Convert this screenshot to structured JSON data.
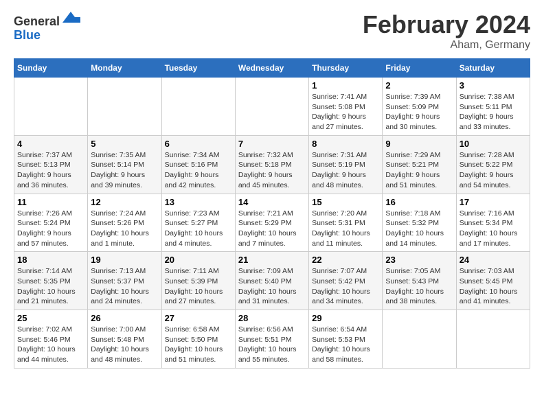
{
  "header": {
    "logo_general": "General",
    "logo_blue": "Blue",
    "main_title": "February 2024",
    "subtitle": "Aham, Germany"
  },
  "days_of_week": [
    "Sunday",
    "Monday",
    "Tuesday",
    "Wednesday",
    "Thursday",
    "Friday",
    "Saturday"
  ],
  "weeks": [
    [
      {
        "day": "",
        "info": ""
      },
      {
        "day": "",
        "info": ""
      },
      {
        "day": "",
        "info": ""
      },
      {
        "day": "",
        "info": ""
      },
      {
        "day": "1",
        "info": "Sunrise: 7:41 AM\nSunset: 5:08 PM\nDaylight: 9 hours and 27 minutes."
      },
      {
        "day": "2",
        "info": "Sunrise: 7:39 AM\nSunset: 5:09 PM\nDaylight: 9 hours and 30 minutes."
      },
      {
        "day": "3",
        "info": "Sunrise: 7:38 AM\nSunset: 5:11 PM\nDaylight: 9 hours and 33 minutes."
      }
    ],
    [
      {
        "day": "4",
        "info": "Sunrise: 7:37 AM\nSunset: 5:13 PM\nDaylight: 9 hours and 36 minutes."
      },
      {
        "day": "5",
        "info": "Sunrise: 7:35 AM\nSunset: 5:14 PM\nDaylight: 9 hours and 39 minutes."
      },
      {
        "day": "6",
        "info": "Sunrise: 7:34 AM\nSunset: 5:16 PM\nDaylight: 9 hours and 42 minutes."
      },
      {
        "day": "7",
        "info": "Sunrise: 7:32 AM\nSunset: 5:18 PM\nDaylight: 9 hours and 45 minutes."
      },
      {
        "day": "8",
        "info": "Sunrise: 7:31 AM\nSunset: 5:19 PM\nDaylight: 9 hours and 48 minutes."
      },
      {
        "day": "9",
        "info": "Sunrise: 7:29 AM\nSunset: 5:21 PM\nDaylight: 9 hours and 51 minutes."
      },
      {
        "day": "10",
        "info": "Sunrise: 7:28 AM\nSunset: 5:22 PM\nDaylight: 9 hours and 54 minutes."
      }
    ],
    [
      {
        "day": "11",
        "info": "Sunrise: 7:26 AM\nSunset: 5:24 PM\nDaylight: 9 hours and 57 minutes."
      },
      {
        "day": "12",
        "info": "Sunrise: 7:24 AM\nSunset: 5:26 PM\nDaylight: 10 hours and 1 minute."
      },
      {
        "day": "13",
        "info": "Sunrise: 7:23 AM\nSunset: 5:27 PM\nDaylight: 10 hours and 4 minutes."
      },
      {
        "day": "14",
        "info": "Sunrise: 7:21 AM\nSunset: 5:29 PM\nDaylight: 10 hours and 7 minutes."
      },
      {
        "day": "15",
        "info": "Sunrise: 7:20 AM\nSunset: 5:31 PM\nDaylight: 10 hours and 11 minutes."
      },
      {
        "day": "16",
        "info": "Sunrise: 7:18 AM\nSunset: 5:32 PM\nDaylight: 10 hours and 14 minutes."
      },
      {
        "day": "17",
        "info": "Sunrise: 7:16 AM\nSunset: 5:34 PM\nDaylight: 10 hours and 17 minutes."
      }
    ],
    [
      {
        "day": "18",
        "info": "Sunrise: 7:14 AM\nSunset: 5:35 PM\nDaylight: 10 hours and 21 minutes."
      },
      {
        "day": "19",
        "info": "Sunrise: 7:13 AM\nSunset: 5:37 PM\nDaylight: 10 hours and 24 minutes."
      },
      {
        "day": "20",
        "info": "Sunrise: 7:11 AM\nSunset: 5:39 PM\nDaylight: 10 hours and 27 minutes."
      },
      {
        "day": "21",
        "info": "Sunrise: 7:09 AM\nSunset: 5:40 PM\nDaylight: 10 hours and 31 minutes."
      },
      {
        "day": "22",
        "info": "Sunrise: 7:07 AM\nSunset: 5:42 PM\nDaylight: 10 hours and 34 minutes."
      },
      {
        "day": "23",
        "info": "Sunrise: 7:05 AM\nSunset: 5:43 PM\nDaylight: 10 hours and 38 minutes."
      },
      {
        "day": "24",
        "info": "Sunrise: 7:03 AM\nSunset: 5:45 PM\nDaylight: 10 hours and 41 minutes."
      }
    ],
    [
      {
        "day": "25",
        "info": "Sunrise: 7:02 AM\nSunset: 5:46 PM\nDaylight: 10 hours and 44 minutes."
      },
      {
        "day": "26",
        "info": "Sunrise: 7:00 AM\nSunset: 5:48 PM\nDaylight: 10 hours and 48 minutes."
      },
      {
        "day": "27",
        "info": "Sunrise: 6:58 AM\nSunset: 5:50 PM\nDaylight: 10 hours and 51 minutes."
      },
      {
        "day": "28",
        "info": "Sunrise: 6:56 AM\nSunset: 5:51 PM\nDaylight: 10 hours and 55 minutes."
      },
      {
        "day": "29",
        "info": "Sunrise: 6:54 AM\nSunset: 5:53 PM\nDaylight: 10 hours and 58 minutes."
      },
      {
        "day": "",
        "info": ""
      },
      {
        "day": "",
        "info": ""
      }
    ]
  ]
}
